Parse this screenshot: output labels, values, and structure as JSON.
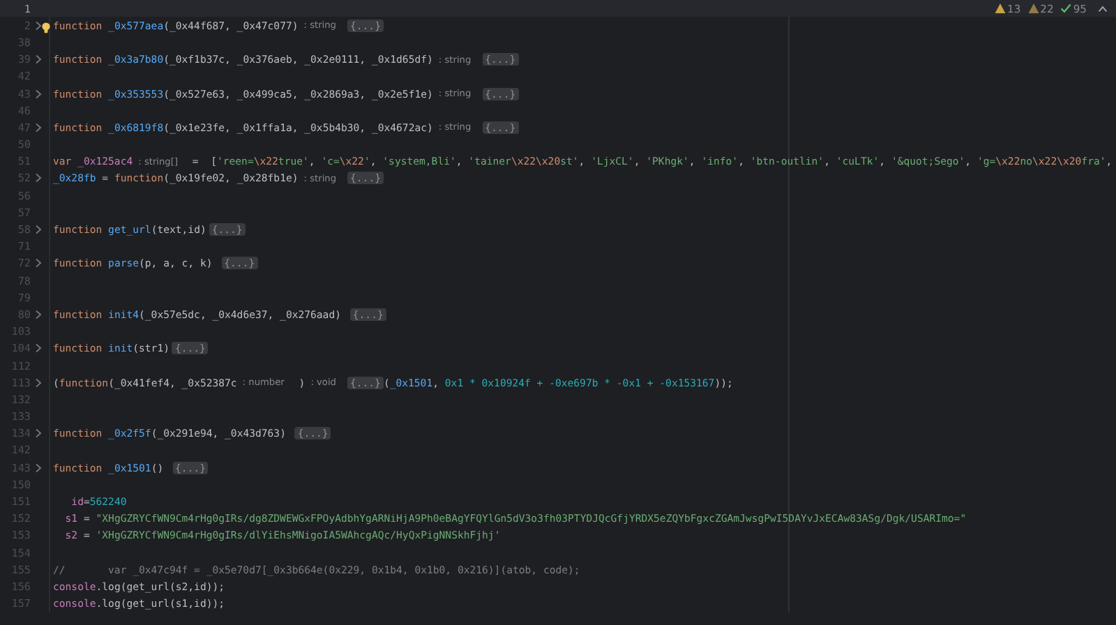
{
  "inspections": [
    {
      "kind": "warning",
      "count": "13"
    },
    {
      "kind": "weak_warning",
      "count": "22"
    },
    {
      "kind": "ok",
      "count": "95"
    }
  ],
  "lines": [
    {
      "number": "1",
      "current": true,
      "foldable": false,
      "bulb": false
    },
    {
      "number": "2",
      "current": false,
      "foldable": true,
      "bulb": true,
      "tokens": [
        {
          "text": "function ",
          "kind": "keyword"
        },
        {
          "text": "_0x577aea",
          "kind": "function"
        },
        {
          "text": "(_0x44f687, _0x47c077)",
          "kind": "plain"
        },
        {
          "text": ": string",
          "kind": "hint"
        },
        {
          "text": "{...}",
          "kind": "fold"
        }
      ]
    },
    {
      "number": "38",
      "current": false,
      "foldable": false,
      "bulb": false
    },
    {
      "number": "39",
      "current": false,
      "foldable": true,
      "bulb": false,
      "tokens": [
        {
          "text": "function ",
          "kind": "keyword"
        },
        {
          "text": "_0x3a7b80",
          "kind": "function"
        },
        {
          "text": "(_0xf1b37c, _0x376aeb, _0x2e0111, _0x1d65df)",
          "kind": "plain"
        },
        {
          "text": ": string",
          "kind": "hint"
        },
        {
          "text": "{...}",
          "kind": "fold"
        }
      ]
    },
    {
      "number": "42",
      "current": false,
      "foldable": false,
      "bulb": false
    },
    {
      "number": "43",
      "current": false,
      "foldable": true,
      "bulb": false,
      "tokens": [
        {
          "text": "function ",
          "kind": "keyword"
        },
        {
          "text": "_0x353553",
          "kind": "function"
        },
        {
          "text": "(_0x527e63, _0x499ca5, _0x2869a3, _0x2e5f1e)",
          "kind": "plain"
        },
        {
          "text": ": string",
          "kind": "hint"
        },
        {
          "text": "{...}",
          "kind": "fold"
        }
      ]
    },
    {
      "number": "46",
      "current": false,
      "foldable": false,
      "bulb": false
    },
    {
      "number": "47",
      "current": false,
      "foldable": true,
      "bulb": false,
      "tokens": [
        {
          "text": "function ",
          "kind": "keyword"
        },
        {
          "text": "_0x6819f8",
          "kind": "function"
        },
        {
          "text": "(_0x1e23fe, _0x1ffa1a, _0x5b4b30, _0x4672ac)",
          "kind": "plain"
        },
        {
          "text": ": string",
          "kind": "hint"
        },
        {
          "text": "{...}",
          "kind": "fold"
        }
      ]
    },
    {
      "number": "50",
      "current": false,
      "foldable": false,
      "bulb": false
    },
    {
      "number": "51",
      "current": false,
      "foldable": false,
      "bulb": false,
      "tokens": [
        {
          "text": "var ",
          "kind": "keyword"
        },
        {
          "text": "_0x125ac4",
          "kind": "variable"
        },
        {
          "text": ": string[]",
          "kind": "hint"
        },
        {
          "text": " =  [",
          "kind": "plain"
        },
        {
          "text": "'reen=",
          "kind": "string"
        },
        {
          "text": "\\x22",
          "kind": "escape"
        },
        {
          "text": "true'",
          "kind": "string"
        },
        {
          "text": ", ",
          "kind": "plain"
        },
        {
          "text": "'c=",
          "kind": "string"
        },
        {
          "text": "\\x22",
          "kind": "escape"
        },
        {
          "text": "'",
          "kind": "string"
        },
        {
          "text": ", ",
          "kind": "plain"
        },
        {
          "text": "'system,Bli'",
          "kind": "string"
        },
        {
          "text": ", ",
          "kind": "plain"
        },
        {
          "text": "'tainer",
          "kind": "string"
        },
        {
          "text": "\\x22\\x20",
          "kind": "escape"
        },
        {
          "text": "st'",
          "kind": "string"
        },
        {
          "text": ", ",
          "kind": "plain"
        },
        {
          "text": "'LjxCL'",
          "kind": "string"
        },
        {
          "text": ", ",
          "kind": "plain"
        },
        {
          "text": "'PKhgk'",
          "kind": "string"
        },
        {
          "text": ", ",
          "kind": "plain"
        },
        {
          "text": "'info'",
          "kind": "string"
        },
        {
          "text": ", ",
          "kind": "plain"
        },
        {
          "text": "'btn-outlin'",
          "kind": "string"
        },
        {
          "text": ", ",
          "kind": "plain"
        },
        {
          "text": "'cuLTk'",
          "kind": "string"
        },
        {
          "text": ", ",
          "kind": "plain"
        },
        {
          "text": "'&quot;Sego'",
          "kind": "string"
        },
        {
          "text": ", ",
          "kind": "plain"
        },
        {
          "text": "'g=",
          "kind": "string"
        },
        {
          "text": "\\x22",
          "kind": "escape"
        },
        {
          "text": "no",
          "kind": "string"
        },
        {
          "text": "\\x22\\x20",
          "kind": "escape"
        },
        {
          "text": "fra'",
          "kind": "string"
        },
        {
          "text": ",",
          "kind": "plain"
        }
      ]
    },
    {
      "number": "52",
      "current": false,
      "foldable": true,
      "bulb": false,
      "tokens": [
        {
          "text": "_0x28fb",
          "kind": "function"
        },
        {
          "text": " = ",
          "kind": "plain"
        },
        {
          "text": "function",
          "kind": "keyword"
        },
        {
          "text": "(_0x19fe02, _0x28fb1e)",
          "kind": "plain"
        },
        {
          "text": ": string",
          "kind": "hint"
        },
        {
          "text": "{...}",
          "kind": "fold"
        }
      ]
    },
    {
      "number": "56",
      "current": false,
      "foldable": false,
      "bulb": false
    },
    {
      "number": "57",
      "current": false,
      "foldable": false,
      "bulb": false
    },
    {
      "number": "58",
      "current": false,
      "foldable": true,
      "bulb": false,
      "tokens": [
        {
          "text": "function ",
          "kind": "keyword"
        },
        {
          "text": "get_url",
          "kind": "function"
        },
        {
          "text": "(text,id)",
          "kind": "plain"
        },
        {
          "text": "{...}",
          "kind": "fold"
        }
      ]
    },
    {
      "number": "71",
      "current": false,
      "foldable": false,
      "bulb": false
    },
    {
      "number": "72",
      "current": false,
      "foldable": true,
      "bulb": false,
      "tokens": [
        {
          "text": "function ",
          "kind": "keyword"
        },
        {
          "text": "parse",
          "kind": "function"
        },
        {
          "text": "(p, a, c, k) ",
          "kind": "plain"
        },
        {
          "text": "{...}",
          "kind": "fold"
        }
      ]
    },
    {
      "number": "78",
      "current": false,
      "foldable": false,
      "bulb": false
    },
    {
      "number": "79",
      "current": false,
      "foldable": false,
      "bulb": false
    },
    {
      "number": "80",
      "current": false,
      "foldable": true,
      "bulb": false,
      "tokens": [
        {
          "text": "function ",
          "kind": "keyword"
        },
        {
          "text": "init4",
          "kind": "function"
        },
        {
          "text": "(_0x57e5dc, _0x4d6e37, _0x276aad) ",
          "kind": "plain"
        },
        {
          "text": "{...}",
          "kind": "fold"
        }
      ]
    },
    {
      "number": "103",
      "current": false,
      "foldable": false,
      "bulb": false
    },
    {
      "number": "104",
      "current": false,
      "foldable": true,
      "bulb": false,
      "tokens": [
        {
          "text": "function ",
          "kind": "keyword"
        },
        {
          "text": "init",
          "kind": "function"
        },
        {
          "text": "(str1)",
          "kind": "plain"
        },
        {
          "text": "{...}",
          "kind": "fold"
        }
      ]
    },
    {
      "number": "112",
      "current": false,
      "foldable": false,
      "bulb": false
    },
    {
      "number": "113",
      "current": false,
      "foldable": true,
      "bulb": false,
      "tokens": [
        {
          "text": "(",
          "kind": "plain"
        },
        {
          "text": "function",
          "kind": "keyword"
        },
        {
          "text": "(_0x41fef4, _0x52387c",
          "kind": "plain"
        },
        {
          "text": ": number",
          "kind": "hint"
        },
        {
          "text": " )",
          "kind": "plain"
        },
        {
          "text": ": void",
          "kind": "hint"
        },
        {
          "text": "{...}",
          "kind": "fold"
        },
        {
          "text": "(",
          "kind": "plain"
        },
        {
          "text": "_0x1501",
          "kind": "function"
        },
        {
          "text": ", ",
          "kind": "plain"
        },
        {
          "text": "0x1 * 0x10924f + -0xe697b * -0x1 + -0x153167",
          "kind": "number"
        },
        {
          "text": "));",
          "kind": "plain"
        }
      ]
    },
    {
      "number": "132",
      "current": false,
      "foldable": false,
      "bulb": false
    },
    {
      "number": "133",
      "current": false,
      "foldable": false,
      "bulb": false
    },
    {
      "number": "134",
      "current": false,
      "foldable": true,
      "bulb": false,
      "tokens": [
        {
          "text": "function ",
          "kind": "keyword"
        },
        {
          "text": "_0x2f5f",
          "kind": "function"
        },
        {
          "text": "(_0x291e94, _0x43d763) ",
          "kind": "plain"
        },
        {
          "text": "{...}",
          "kind": "fold"
        }
      ]
    },
    {
      "number": "142",
      "current": false,
      "foldable": false,
      "bulb": false
    },
    {
      "number": "143",
      "current": false,
      "foldable": true,
      "bulb": false,
      "tokens": [
        {
          "text": "function ",
          "kind": "keyword"
        },
        {
          "text": "_0x1501",
          "kind": "function"
        },
        {
          "text": "() ",
          "kind": "plain"
        },
        {
          "text": "{...}",
          "kind": "fold"
        }
      ]
    },
    {
      "number": "150",
      "current": false,
      "foldable": false,
      "bulb": false
    },
    {
      "number": "151",
      "current": false,
      "foldable": false,
      "bulb": false,
      "tokens": [
        {
          "text": "   id",
          "kind": "variable"
        },
        {
          "text": "=",
          "kind": "plain"
        },
        {
          "text": "562240",
          "kind": "number"
        }
      ]
    },
    {
      "number": "152",
      "current": false,
      "foldable": false,
      "bulb": false,
      "tokens": [
        {
          "text": "  s1",
          "kind": "variable"
        },
        {
          "text": " = ",
          "kind": "plain"
        },
        {
          "text": "\"XHgGZRYCfWN9Cm4rHg0gIRs/dg8ZDWEWGxFPOyAdbhYgARNiHjA9Ph0eBAgYFQYlGn5dV3o3fh03PTYDJQcGfjYRDX5eZQYbFgxcZGAmJwsgPwI5DAYvJxECAw83ASg/Dgk/USARImo=\"",
          "kind": "string"
        }
      ]
    },
    {
      "number": "153",
      "current": false,
      "foldable": false,
      "bulb": false,
      "tokens": [
        {
          "text": "  s2",
          "kind": "variable"
        },
        {
          "text": " = ",
          "kind": "plain"
        },
        {
          "text": "'XHgGZRYCfWN9Cm4rHg0gIRs/dlYiEhsMNigoIA5WAhcgAQc/HyQxPigNNSkhFjhj'",
          "kind": "string"
        }
      ]
    },
    {
      "number": "154",
      "current": false,
      "foldable": false,
      "bulb": false
    },
    {
      "number": "155",
      "current": false,
      "foldable": false,
      "bulb": false,
      "tokens": [
        {
          "text": "//       var _0x47c94f = _0x5e70d7[_0x3b664e(0x229, 0x1b4, 0x1b0, 0x216)](atob, code);",
          "kind": "comment"
        }
      ]
    },
    {
      "number": "156",
      "current": false,
      "foldable": false,
      "bulb": false,
      "tokens": [
        {
          "text": "console",
          "kind": "variable"
        },
        {
          "text": ".log(get_url(s2,id));",
          "kind": "plain"
        }
      ]
    },
    {
      "number": "157",
      "current": false,
      "foldable": false,
      "bulb": false,
      "tokens": [
        {
          "text": "console",
          "kind": "variable"
        },
        {
          "text": ".log(get_url(s1,id));",
          "kind": "plain"
        }
      ]
    }
  ]
}
